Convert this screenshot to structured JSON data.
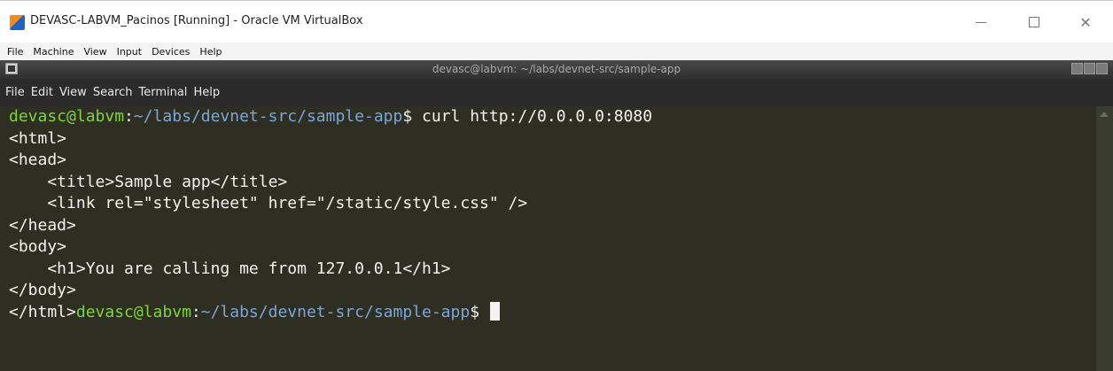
{
  "host_window": {
    "title": "DEVASC-LABVM_Pacinos [Running] - Oracle VM VirtualBox",
    "minimize": "",
    "close": "✕"
  },
  "host_menu": [
    "File",
    "Machine",
    "View",
    "Input",
    "Devices",
    "Help"
  ],
  "terminal_window": {
    "title": "devasc@labvm: ~/labs/devnet-src/sample-app"
  },
  "terminal_menu": [
    "File",
    "Edit",
    "View",
    "Search",
    "Terminal",
    "Help"
  ],
  "terminal": {
    "prompt_user": "devasc@labvm",
    "prompt_sep": ":",
    "prompt_path": "~/labs/devnet-src/sample-app",
    "prompt_end": "$",
    "command": " curl http://0.0.0.0:8080",
    "output_lines": [
      "<html>",
      "<head>",
      "    <title>Sample app</title>",
      "    <link rel=\"stylesheet\" href=\"/static/style.css\" />",
      "</head>",
      "<body>",
      "    <h1>You are calling me from 127.0.0.1</h1>",
      "</body>"
    ],
    "last_output": "</html>"
  }
}
